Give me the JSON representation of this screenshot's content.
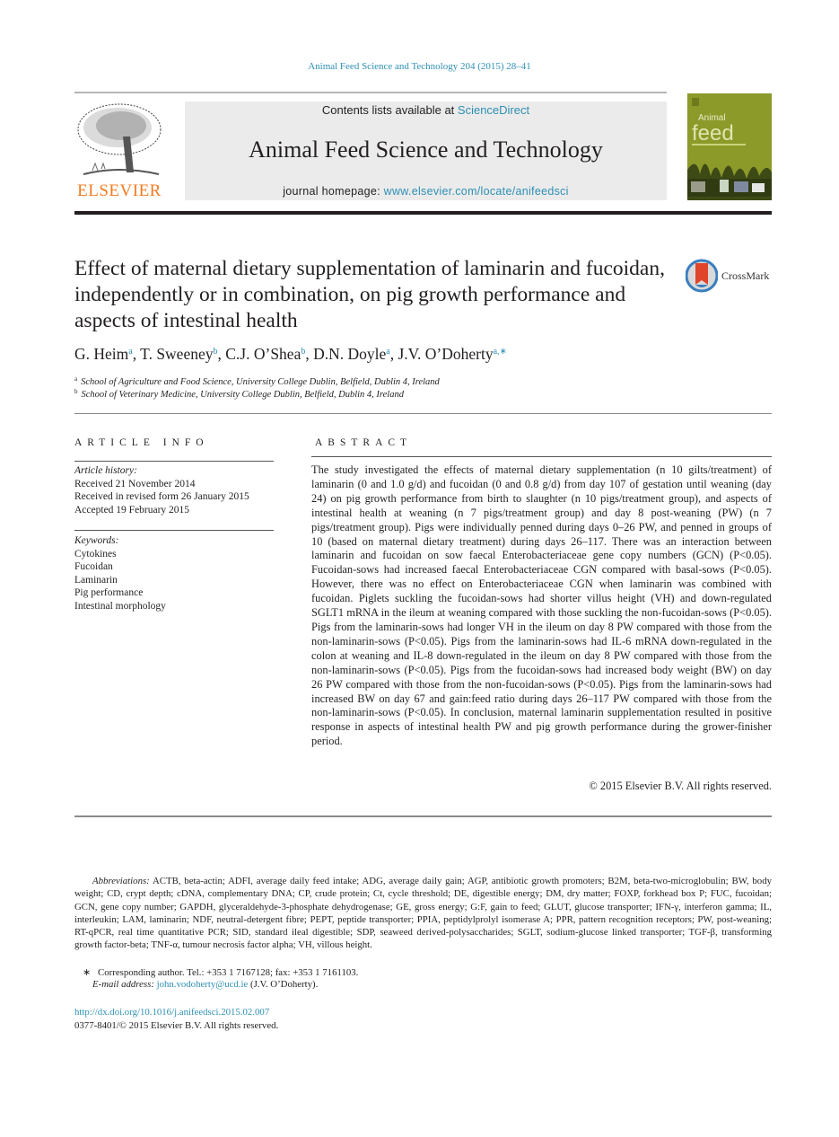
{
  "header": {
    "journal_reference": "Animal Feed Science and Technology 204 (2015) 28–41",
    "contents_prefix": "Contents lists available at ",
    "contents_link": "ScienceDirect",
    "journal_title": "Animal Feed Science and Technology",
    "homepage_prefix": "journal homepage: ",
    "homepage_link": "www.elsevier.com/locate/anifeedsci",
    "publisher_logo_text": "ELSEVIER",
    "cover_title_small": "Animal",
    "cover_title_large": "feed",
    "crossmark_label": "CrossMark"
  },
  "article": {
    "title": "Effect of maternal dietary supplementation of laminarin and fucoidan, independently or in combination, on pig growth performance and aspects of intestinal health",
    "authors": [
      {
        "name": "G. Heim",
        "sup": "a"
      },
      {
        "name": "T. Sweeney",
        "sup": "b"
      },
      {
        "name": "C.J. O’Shea",
        "sup": "b"
      },
      {
        "name": "D.N. Doyle",
        "sup": "a"
      },
      {
        "name": "J.V. O’Doherty",
        "sup": "a,∗"
      }
    ],
    "affiliations": [
      {
        "sup": "a",
        "text": "School of Agriculture and Food Science, University College Dublin, Belfield, Dublin 4, Ireland"
      },
      {
        "sup": "b",
        "text": "School of Veterinary Medicine, University College Dublin, Belfield, Dublin 4, Ireland"
      }
    ]
  },
  "article_info": {
    "heading": "ARTICLE INFO",
    "history_label": "Article history:",
    "history": [
      "Received 21 November 2014",
      "Received in revised form 26 January 2015",
      "Accepted 19 February 2015"
    ],
    "keywords_label": "Keywords:",
    "keywords": [
      "Cytokines",
      "Fucoidan",
      "Laminarin",
      "Pig performance",
      "Intestinal morphology"
    ]
  },
  "abstract": {
    "heading": "ABSTRACT",
    "text": "The study investigated the effects of maternal dietary supplementation (n 10 gilts/treatment) of laminarin (0 and 1.0 g/d) and fucoidan (0 and 0.8 g/d) from day 107 of gestation until weaning (day 24) on pig growth performance from birth to slaughter (n 10 pigs/treatment group), and aspects of intestinal health at weaning (n 7 pigs/treatment group) and day 8 post-weaning (PW) (n 7 pigs/treatment group). Pigs were individually penned during days 0–26 PW, and penned in groups of 10 (based on maternal dietary treatment) during days 26–117. There was an interaction between laminarin and fucoidan on sow faecal Enterobacteriaceae gene copy numbers (GCN) (P<0.05). Fucoidan-sows had increased faecal Enterobacteriaceae CGN compared with basal-sows (P<0.05). However, there was no effect on Enterobacteriaceae CGN when laminarin was combined with fucoidan. Piglets suckling the fucoidan-sows had shorter villus height (VH) and down-regulated SGLT1 mRNA in the ileum at weaning compared with those suckling the non-fucoidan-sows (P<0.05). Pigs from the laminarin-sows had longer VH in the ileum on day 8 PW compared with those from the non-laminarin-sows (P<0.05). Pigs from the laminarin-sows had IL-6 mRNA down-regulated in the colon at weaning and IL-8 down-regulated in the ileum on day 8 PW compared with those from the non-laminarin-sows (P<0.05). Pigs from the fucoidan-sows had increased body weight (BW) on day 26 PW compared with those from the non-fucoidan-sows (P<0.05). Pigs from the laminarin-sows had increased BW on day 67 and gain:feed ratio during days 26–117 PW compared with those from the non-laminarin-sows (P<0.05). In conclusion, maternal laminarin supplementation resulted in positive response in aspects of intestinal health PW and pig growth performance during the grower-finisher period.",
    "copyright": "© 2015 Elsevier B.V. All rights reserved."
  },
  "footnotes": {
    "abbreviations_label": "Abbreviations:",
    "abbreviations_text": "ACTB, beta-actin; ADFI, average daily feed intake; ADG, average daily gain; AGP, antibiotic growth promoters; B2M, beta-two-microglobulin; BW, body weight; CD, crypt depth; cDNA, complementary DNA; CP, crude protein; Ct, cycle threshold; DE, digestible energy; DM, dry matter; FOXP, forkhead box P; FUC, fucoidan; GCN, gene copy number; GAPDH, glyceraldehyde-3-phosphate dehydrogenase; GE, gross energy; G:F, gain to feed; GLUT, glucose transporter; IFN-γ, interferon gamma; IL, interleukin; LAM, laminarin; NDF, neutral-detergent fibre; PEPT, peptide transporter; PPIA, peptidylprolyl isomerase A; PPR, pattern recognition receptors; PW, post-weaning; RT-qPCR, real time quantitative PCR; SID, standard ileal digestible; SDP, seaweed derived-polysaccharides; SGLT, sodium-glucose linked transporter; TGF-β, transforming growth factor-beta; TNF-α, tumour necrosis factor alpha; VH, villous height.",
    "corresponding_mark": "∗",
    "corresponding_text": "Corresponding author. Tel.: +353 1 7167128; fax: +353 1 7161103.",
    "email_label": "E-mail address: ",
    "email": "john.vodoherty@ucd.ie",
    "email_suffix": " (J.V. O’Doherty).",
    "doi": "http://dx.doi.org/10.1016/j.anifeedsci.2015.02.007",
    "issn_line": "0377-8401/© 2015 Elsevier B.V. All rights reserved."
  },
  "colors": {
    "link": "#2e8fb4",
    "elsevier_orange": "#f47b20",
    "header_box": "#ebebeb",
    "cover_green": "#8c9a2a"
  }
}
